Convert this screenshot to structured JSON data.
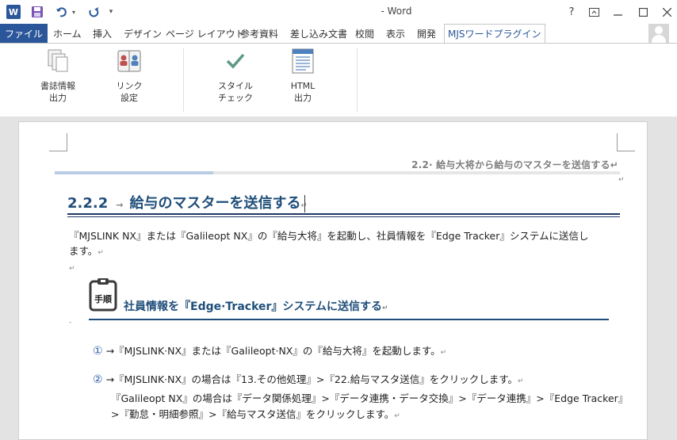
{
  "titlebar": {
    "title": "- Word",
    "logo_letter": "W",
    "help": "?",
    "icons": [
      "word-logo",
      "save-icon",
      "undo-icon",
      "redo-icon",
      "customize-qat-icon",
      "help-icon",
      "ribbon-display-icon",
      "minimize-icon",
      "maximize-icon",
      "close-icon"
    ]
  },
  "tabs": {
    "file": "ファイル",
    "home": "ホーム",
    "insert": "挿入",
    "design": "デザイン",
    "layout": "ページ レイアウト",
    "references": "参考資料",
    "mailings": "差し込み文書",
    "review": "校閲",
    "view": "表示",
    "developer": "開発",
    "mjs": "MJSワードプラグイン"
  },
  "ribbon": {
    "bibliography": "書誌情報\n出力",
    "link": "リンク\n設定",
    "style_check": "スタイル\nチェック",
    "html_output": "HTML\n出力"
  },
  "document": {
    "running_header": "2.2· 給与大将から給与のマスターを送信する↵",
    "running_header_mark": "↵",
    "heading_num": "2.2.2",
    "heading_arrow": "→",
    "heading_text": "給与のマスターを送信する",
    "heading_mark": "↵",
    "intro_line1": "『MJSLINK NX』または『Galileopt NX』の『給与大将』を起動し、社員情報を『Edge Tracker』システムに送信し",
    "intro_line2": "ます。",
    "para_mark": "↵",
    "procedure_icon_label": "手順",
    "procedure_title": "社員情報を『Edge·Tracker』システムに送信する",
    "dash": "-",
    "step1_num": "①",
    "step1_text": "→『MJSLINK·NX』または『Galileopt·NX』の『給与大将』を起動します。",
    "step2_num": "②",
    "step2_text": "→『MJSLINK·NX』の場合は『13.その他処理』>『22.給与マスタ送信』をクリックします。",
    "substep_a": "『Galileopt NX』の場合は『データ関係処理』>『データ連携・データ交換』>『データ連携』>『Edge Tracker』",
    "substep_b": ">『勤怠・明細参照』>『給与マスタ送信』をクリックします。"
  }
}
